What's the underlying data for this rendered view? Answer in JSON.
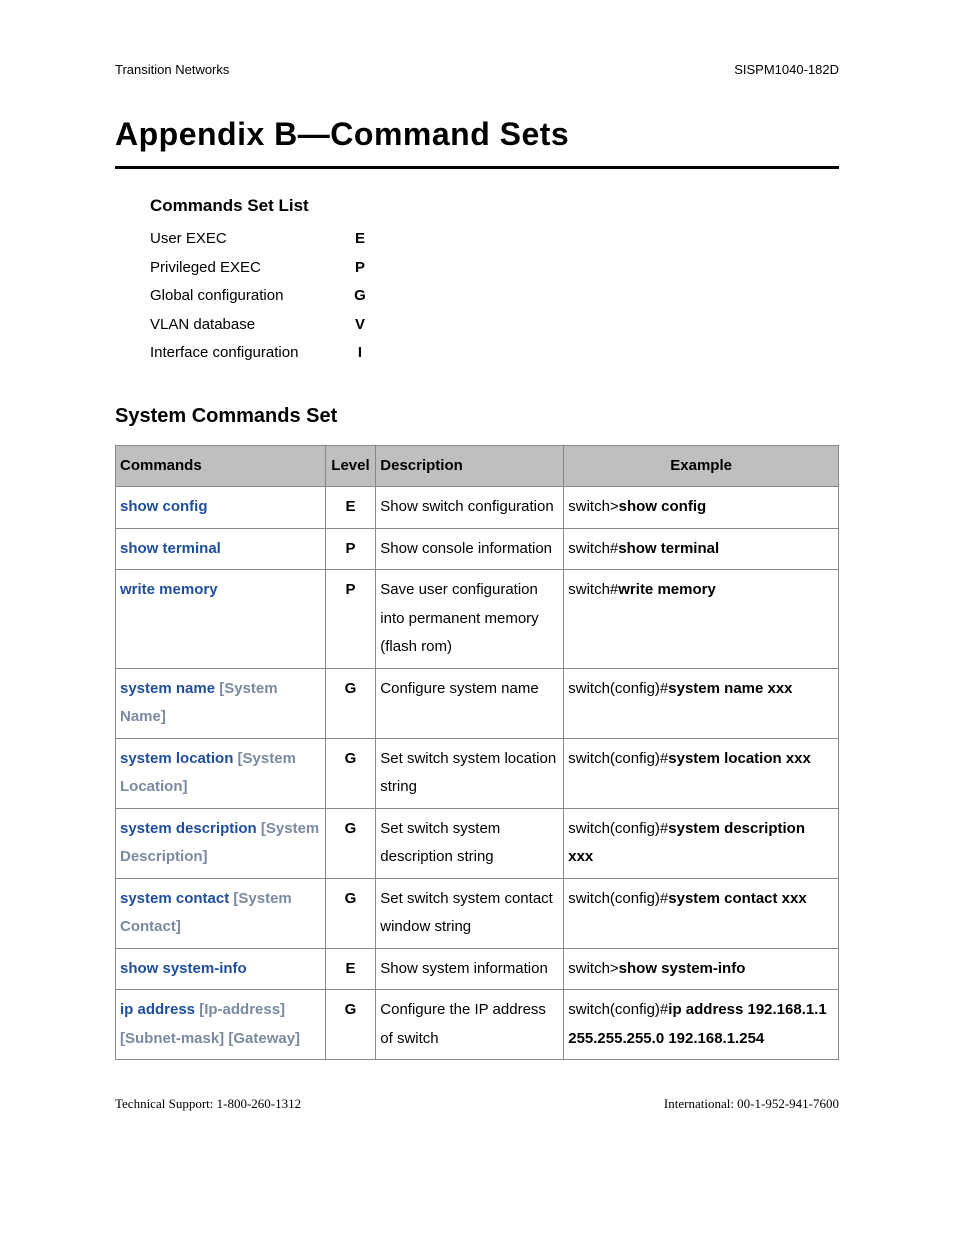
{
  "header": {
    "left": "Transition Networks",
    "right": "SISPM1040-182D"
  },
  "title": "Appendix B—Command Sets",
  "commandsSetList": {
    "heading": "Commands Set List",
    "items": [
      {
        "name": "User EXEC",
        "code": "E"
      },
      {
        "name": "Privileged EXEC",
        "code": "P"
      },
      {
        "name": "Global configuration",
        "code": "G"
      },
      {
        "name": "VLAN database",
        "code": "V"
      },
      {
        "name": "Interface configuration",
        "code": "I"
      }
    ]
  },
  "systemCommands": {
    "heading": "System Commands Set",
    "columns": {
      "commands": "Commands",
      "level": "Level",
      "description": "Description",
      "example": "Example"
    },
    "rows": [
      {
        "cmd": "show config",
        "param": "",
        "level": "E",
        "desc": "Show switch configuration",
        "exPrefix": "switch>",
        "exBold": "show config"
      },
      {
        "cmd": "show terminal",
        "param": "",
        "level": "P",
        "desc": "Show console information",
        "exPrefix": "switch#",
        "exBold": "show terminal"
      },
      {
        "cmd": "write memory",
        "param": "",
        "level": "P",
        "desc": "Save user configuration into permanent memory (flash rom)",
        "exPrefix": "switch#",
        "exBold": "write memory"
      },
      {
        "cmd": "system name",
        "param": "[System Name]",
        "level": "G",
        "desc": "Configure system name",
        "exPrefix": "switch(config)#",
        "exBold": "system name xxx"
      },
      {
        "cmd": "system location",
        "param": "[System Location]",
        "level": "G",
        "desc": "Set switch system location string",
        "exPrefix": "switch(config)#",
        "exBold": "system location xxx"
      },
      {
        "cmd": "system description",
        "param": "[System Description]",
        "level": "G",
        "desc": "Set switch system description string",
        "exPrefix": "switch(config)#",
        "exBold": "system description xxx"
      },
      {
        "cmd": "system contact",
        "param": "[System Contact]",
        "level": "G",
        "desc": "Set switch system contact window string",
        "exPrefix": "switch(config)#",
        "exBold": "system contact xxx"
      },
      {
        "cmd": "show system-info",
        "param": "",
        "level": "E",
        "desc": "Show system information",
        "exPrefix": "switch>",
        "exBold": "show system-info"
      },
      {
        "cmd": "ip address",
        "param": "[Ip-address] [Subnet-mask] [Gateway]",
        "level": "G",
        "desc": "Configure the IP address of switch",
        "exPrefix": "switch(config)#",
        "exBold": "ip address 192.168.1.1 255.255.255.0 192.168.1.254"
      }
    ]
  },
  "footer": {
    "left": "Technical Support: 1-800-260-1312",
    "right": "International: 00-1-952-941-7600"
  }
}
